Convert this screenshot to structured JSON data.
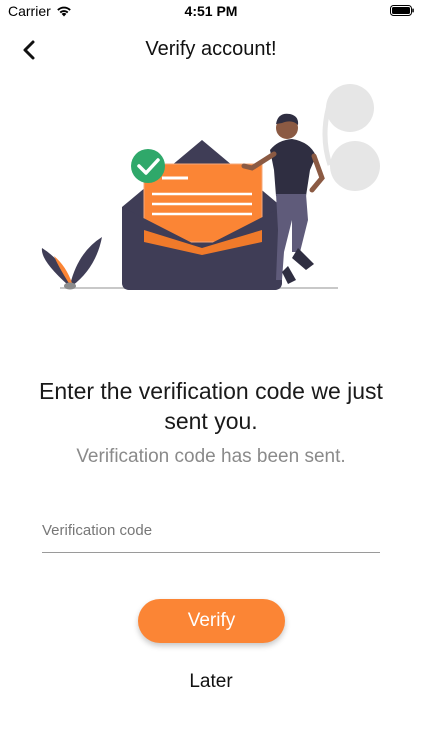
{
  "status_bar": {
    "carrier": "Carrier",
    "time": "4:51 PM",
    "icons": [
      "wifi-icon",
      "battery-icon"
    ]
  },
  "nav": {
    "title": "Verify account!",
    "back_icon": "chevron-left-icon"
  },
  "content": {
    "heading": "Enter the verification code we just sent you.",
    "subheading": "Verification code has been sent.",
    "code_placeholder": "Verification code",
    "verify_label": "Verify",
    "later_label": "Later"
  },
  "colors": {
    "accent": "#fb8535",
    "envelope": "#3f3d56",
    "check": "#2fa86a"
  }
}
